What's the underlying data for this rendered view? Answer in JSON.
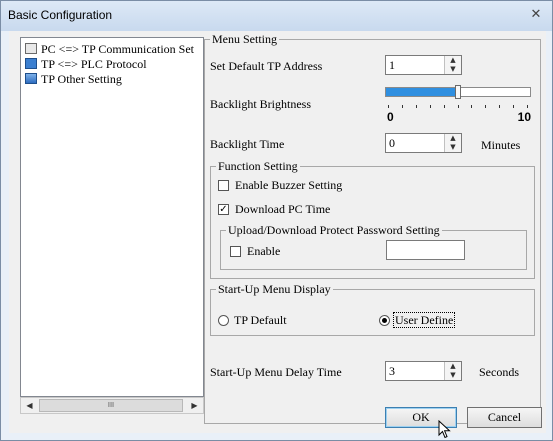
{
  "window": {
    "title": "Basic Configuration"
  },
  "tree": {
    "items": [
      {
        "label": "PC <=> TP Communication Set",
        "icon": "pc-comm-icon"
      },
      {
        "label": "TP <=> PLC Protocol",
        "icon": "plc-protocol-icon"
      },
      {
        "label": "TP Other Setting",
        "icon": "other-setting-icon"
      }
    ],
    "scroll_thumb_label": "III"
  },
  "menu_setting": {
    "group_label": "Menu Setting",
    "tp_address_label": "Set Default TP Address",
    "tp_address_value": "1",
    "backlight_brightness_label": "Backlight Brightness",
    "brightness_min": "0",
    "brightness_max": "10",
    "brightness_value": 5,
    "backlight_time_label": "Backlight Time",
    "backlight_time_value": "0",
    "backlight_time_unit": "Minutes"
  },
  "function_setting": {
    "group_label": "Function Setting",
    "buzzer_label": "Enable Buzzer Setting",
    "buzzer_checked": false,
    "download_pc_time_label": "Download PC Time",
    "download_pc_time_checked": true,
    "check_mark": "✓",
    "password_group_label": "Upload/Download Protect Password Setting",
    "enable_label": "Enable",
    "enable_checked": false,
    "password_value": ""
  },
  "startup_menu": {
    "group_label": "Start-Up Menu Display",
    "tp_default_label": "TP Default",
    "user_define_label": "User Define",
    "selected": "User Define"
  },
  "startup_delay": {
    "label": "Start-Up Menu Delay Time",
    "value": "3",
    "unit": "Seconds"
  },
  "buttons": {
    "ok": "OK",
    "cancel": "Cancel"
  },
  "glyphs": {
    "close": "✕",
    "up": "▲",
    "down": "▼",
    "left": "◀",
    "right": "▶"
  },
  "colors": {
    "slider_fill": "#2f8fe0",
    "title_bar": "#c8d9ee"
  }
}
